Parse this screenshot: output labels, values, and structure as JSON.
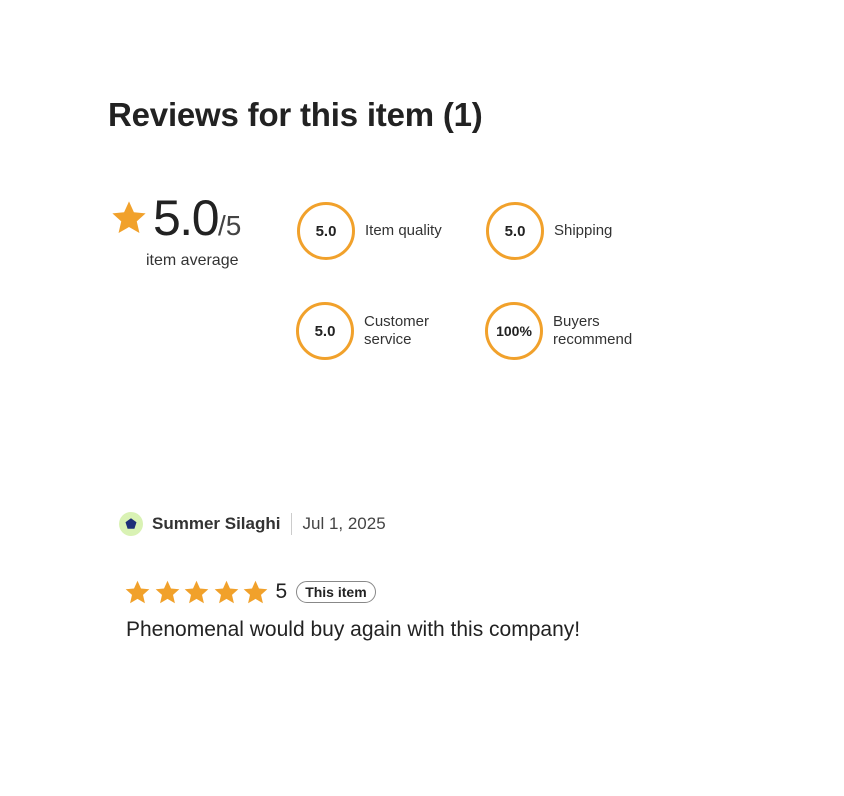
{
  "reviews": {
    "heading": "Reviews for this item (1)",
    "average": {
      "value": "5.0",
      "out_of": "/5",
      "label": "item average",
      "icon": "star-icon"
    },
    "metrics": [
      {
        "value": "5.0",
        "label": "Item quality"
      },
      {
        "value": "5.0",
        "label": "Shipping"
      },
      {
        "value": "5.0",
        "label": "Customer service"
      },
      {
        "value": "100%",
        "label": "Buyers recommend"
      }
    ],
    "review": {
      "reviewer_name": "Summer Silaghi",
      "date": "Jul 1, 2025",
      "rating": "5",
      "stars": 5,
      "badge": "This item",
      "text": "Phenomenal would buy again with this company!"
    }
  },
  "colors": {
    "accent": "#f1a12b",
    "avatar_bg": "#d9f2b4",
    "avatar_icon": "#1e2f78",
    "text": "#222222"
  }
}
